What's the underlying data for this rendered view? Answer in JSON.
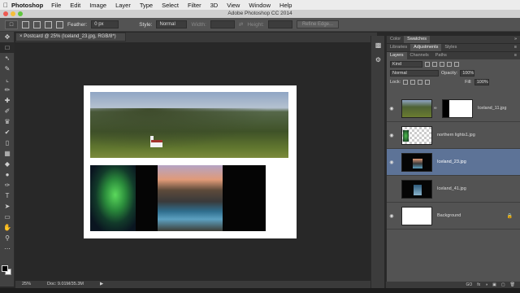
{
  "menubar": {
    "apple": "",
    "app": "Photoshop",
    "items": [
      "File",
      "Edit",
      "Image",
      "Layer",
      "Type",
      "Select",
      "Filter",
      "3D",
      "View",
      "Window",
      "Help"
    ]
  },
  "window": {
    "title": "Adobe Photoshop CC 2014"
  },
  "options": {
    "feather_label": "Feather:",
    "feather_value": "0 px",
    "style_label": "Style:",
    "style_value": "Normal",
    "width_label": "Width:",
    "height_label": "Height:",
    "refine_edge": "Refine Edge..."
  },
  "document": {
    "tab_title": "Postcard @ 25% (Iceland_23.jpg, RGB/8*)",
    "close": "×"
  },
  "status": {
    "zoom": "25%",
    "doc": "Doc: 9.01M/35.3M"
  },
  "panels": {
    "top_tabs": [
      "Color",
      "Swatches"
    ],
    "mid_tabs": [
      "Libraries",
      "Adjustments",
      "Styles"
    ],
    "layer_tabs": [
      "Layers",
      "Channels",
      "Paths"
    ],
    "kind_label": "Kind",
    "blend_mode": "Normal",
    "opacity_label": "Opacity:",
    "opacity_value": "100%",
    "lock_label": "Lock:",
    "fill_label": "Fill:",
    "fill_value": "100%"
  },
  "layers": [
    {
      "name": "Iceland_11.jpg",
      "visible": true,
      "selected": false
    },
    {
      "name": "northern lights1.jpg",
      "visible": true,
      "selected": false
    },
    {
      "name": "Iceland_23.jpg",
      "visible": true,
      "selected": true
    },
    {
      "name": "Iceland_41.jpg",
      "visible": false,
      "selected": false
    },
    {
      "name": "Background",
      "visible": true,
      "selected": false
    }
  ],
  "icons": {
    "eye": "◉",
    "lock": "🔒",
    "chain": "∞",
    "menu": "≡",
    "collapse": "»"
  },
  "footer_icons": [
    "GO",
    "fx",
    "◑",
    "▣",
    "▢",
    "🗑"
  ],
  "colors": {
    "selection": "#5d7397",
    "panel": "#535353",
    "canvas_bg": "#282828"
  }
}
